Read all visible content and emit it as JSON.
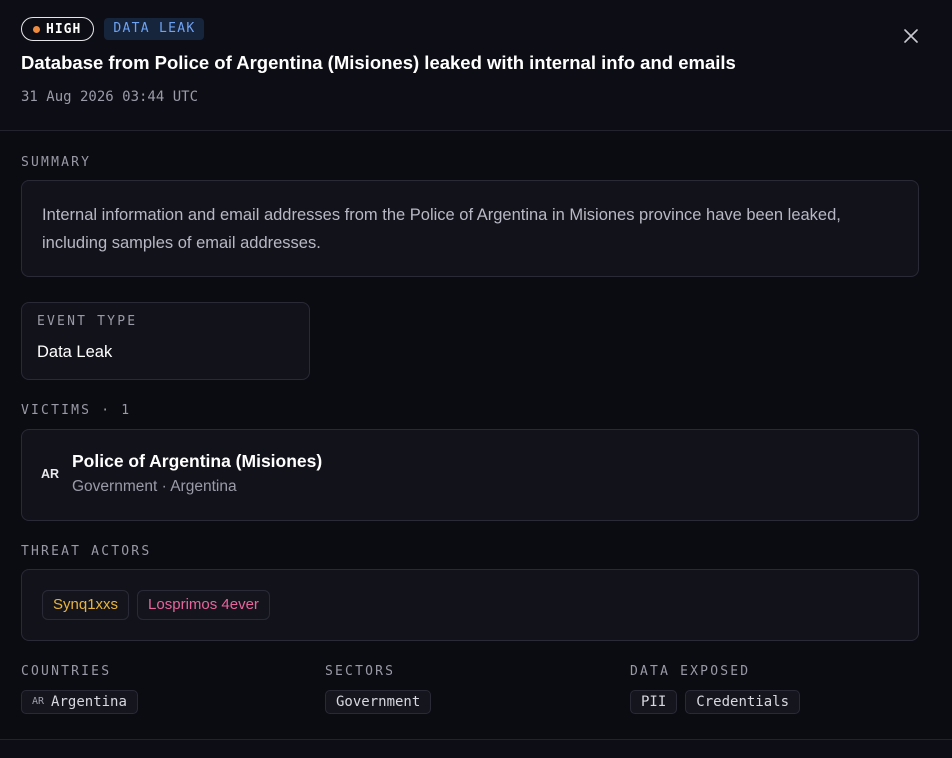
{
  "header": {
    "severity": "HIGH",
    "event_badge": "DATA LEAK",
    "title": "Database from Police of Argentina (Misiones) leaked with internal info and emails",
    "timestamp": "31 Aug 2026 03:44 UTC",
    "close_icon": "close-icon"
  },
  "summary": {
    "label": "SUMMARY",
    "text": "Internal information and email addresses from the Police of Argentina in Misiones province have been leaked, including samples of email addresses."
  },
  "event_type": {
    "label": "EVENT TYPE",
    "value": "Data Leak"
  },
  "victims": {
    "label": "VICTIMS · 1",
    "items": [
      {
        "code": "AR",
        "name": "Police of Argentina (Misiones)",
        "meta": "Government · Argentina"
      }
    ]
  },
  "threat_actors": {
    "label": "THREAT ACTORS",
    "items": [
      {
        "name": "Synq1xxs",
        "color": "#e9b43a"
      },
      {
        "name": "Losprimos 4ever",
        "color": "#e8649b"
      }
    ]
  },
  "countries": {
    "label": "COUNTRIES",
    "items": [
      {
        "code": "AR",
        "name": "Argentina"
      }
    ]
  },
  "sectors": {
    "label": "SECTORS",
    "items": [
      "Government"
    ]
  },
  "data_exposed": {
    "label": "DATA EXPOSED",
    "items": [
      "PII",
      "Credentials"
    ]
  },
  "colors": {
    "severity_dot": "#f08a3c",
    "event_badge_text": "#6ea3f3",
    "background": "#0b0b12"
  }
}
